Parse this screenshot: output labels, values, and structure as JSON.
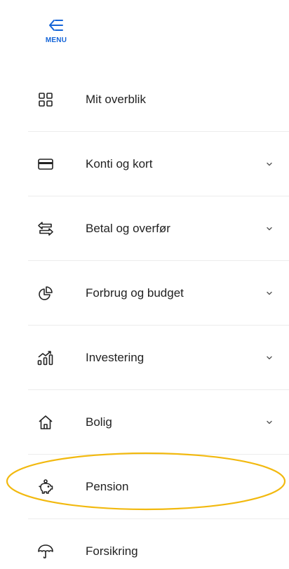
{
  "menu": {
    "label": "MENU",
    "icon": "arrow-left-menu-icon",
    "accent_color": "#1565d8"
  },
  "nav": {
    "items": [
      {
        "label": "Mit overblik",
        "icon": "dashboard-grid-icon",
        "expandable": false
      },
      {
        "label": "Konti og kort",
        "icon": "credit-card-icon",
        "expandable": true
      },
      {
        "label": "Betal og overfør",
        "icon": "transfer-arrows-icon",
        "expandable": true
      },
      {
        "label": "Forbrug og budget",
        "icon": "pie-chart-icon",
        "expandable": true
      },
      {
        "label": "Investering",
        "icon": "growth-chart-icon",
        "expandable": true
      },
      {
        "label": "Bolig",
        "icon": "house-icon",
        "expandable": true
      },
      {
        "label": "Pension",
        "icon": "piggy-bank-icon",
        "expandable": false,
        "highlighted": true
      },
      {
        "label": "Forsikring",
        "icon": "umbrella-icon",
        "expandable": false
      }
    ]
  },
  "highlight_color": "#f2b90f"
}
